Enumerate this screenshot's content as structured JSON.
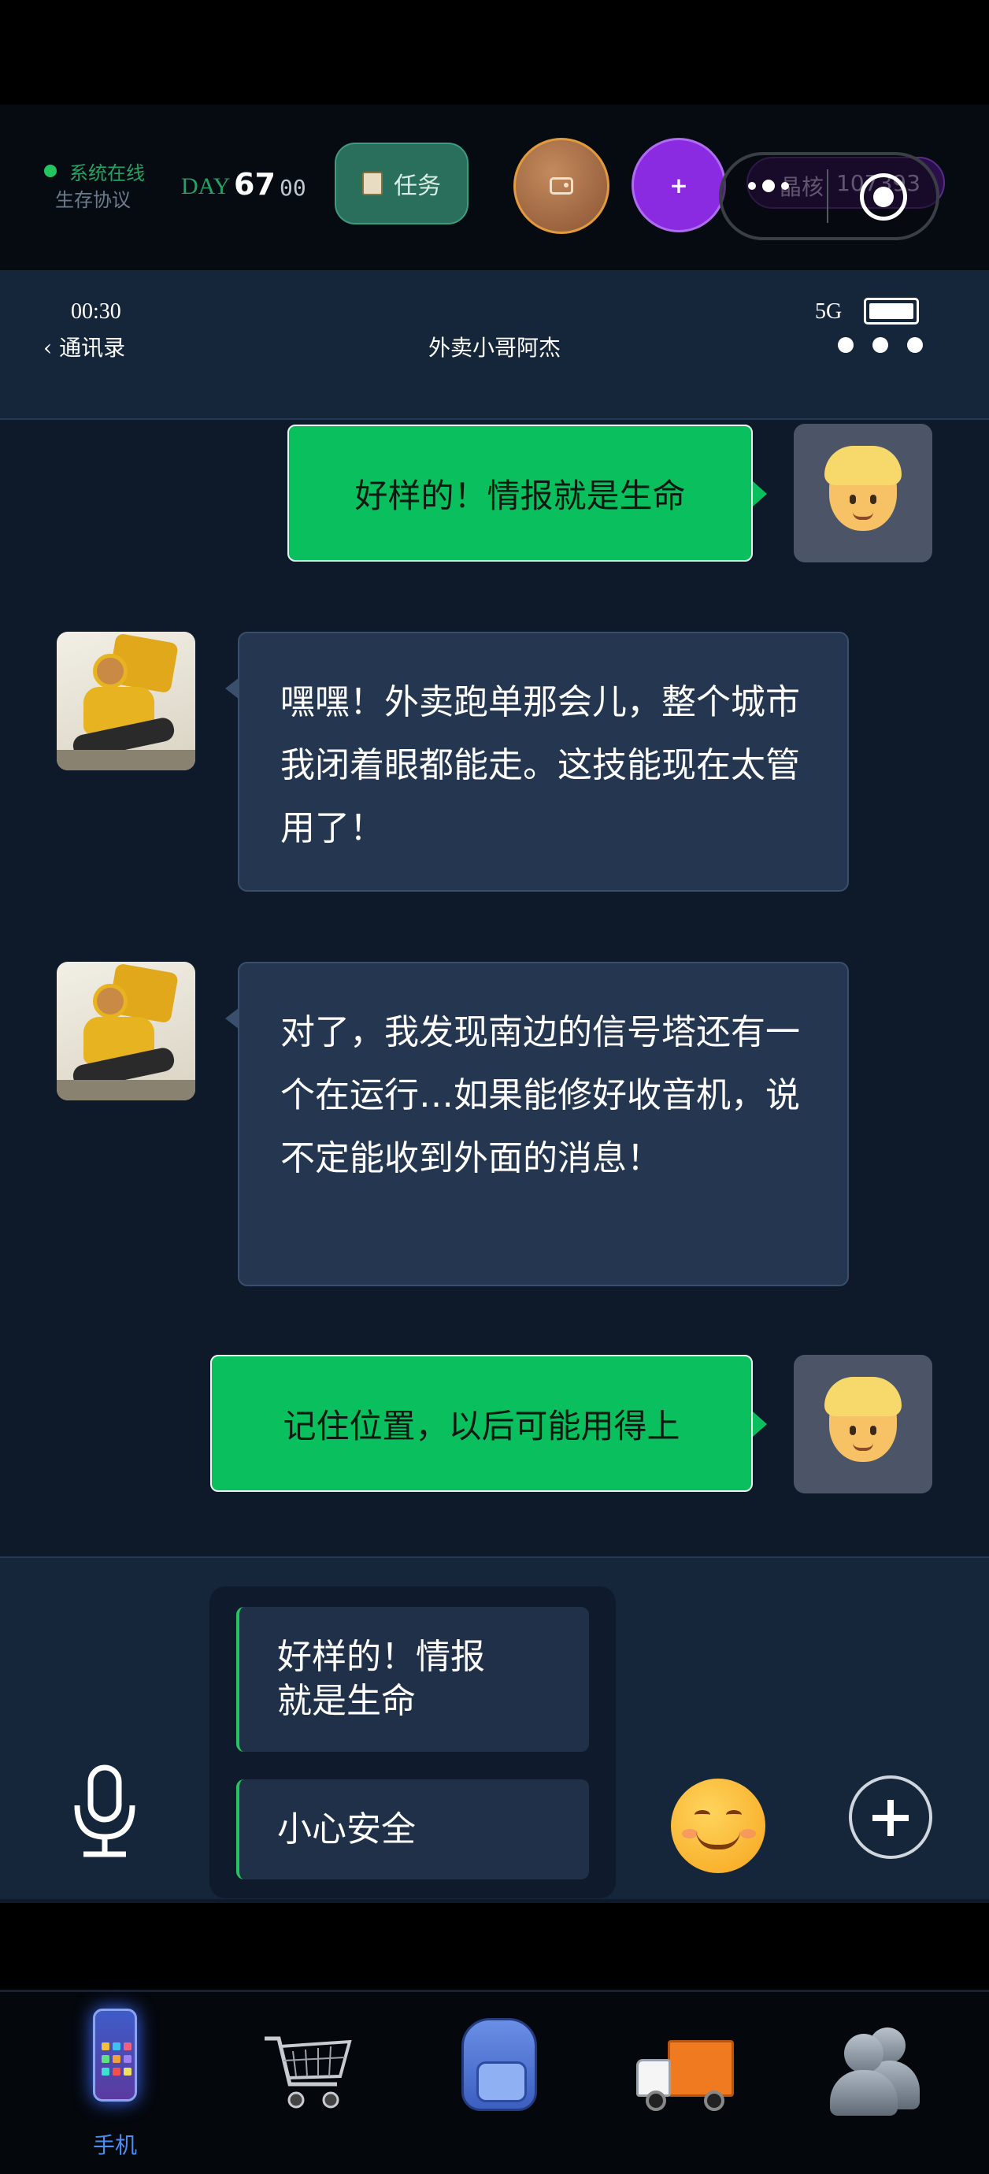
{
  "hud": {
    "status_online": "系统在线",
    "status_protocol": "生存协议",
    "day_label": "DAY",
    "day_number": "67",
    "day_sub": "00",
    "task_button_label": "任务",
    "crystal_label": "晶核",
    "crystal_value": "107393",
    "plus_label": "+",
    "accent_green": "#22c55e",
    "accent_purple": "#8a2be2"
  },
  "phone": {
    "time": "00:30",
    "network": "5G",
    "back_label": "通讯录",
    "chat_title": "外卖小哥阿杰"
  },
  "messages": [
    {
      "sender": "me",
      "text": "好样的！情报就是生命"
    },
    {
      "sender": "npc",
      "text": "嘿嘿！外卖跑单那会儿，整个城市我闭着眼都能走。这技能现在太管用了！"
    },
    {
      "sender": "npc",
      "text": "对了，我发现南边的信号塔还有一个在运行…如果能修好收音机，说不定能收到外面的消息！"
    },
    {
      "sender": "me",
      "text": "记住位置，以后可能用得上"
    }
  ],
  "quick_replies": [
    "好样的！情报就是生命",
    "小心安全"
  ],
  "nav": {
    "items": [
      {
        "icon": "phone-icon",
        "label": "手机",
        "active": true
      },
      {
        "icon": "cart-icon",
        "label": ""
      },
      {
        "icon": "backpack-icon",
        "label": ""
      },
      {
        "icon": "truck-icon",
        "label": ""
      },
      {
        "icon": "people-icon",
        "label": ""
      }
    ],
    "active_color": "#4b8df0"
  }
}
